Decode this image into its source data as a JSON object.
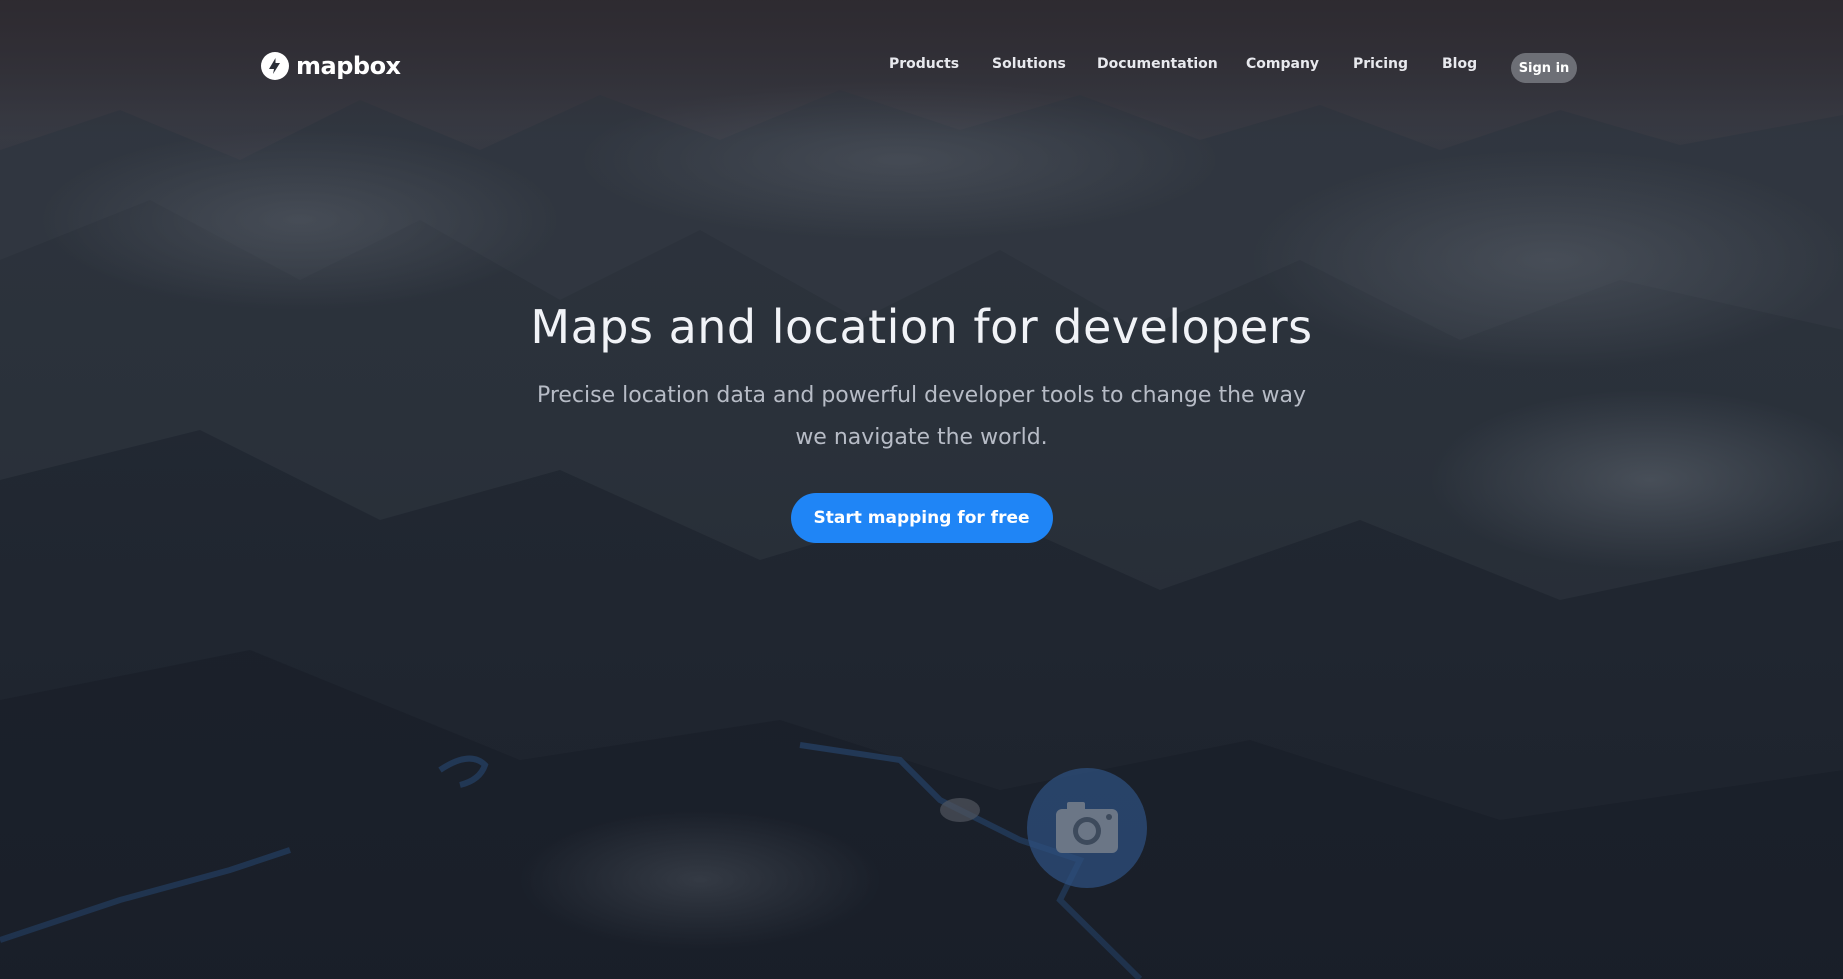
{
  "brand": {
    "name": "mapbox",
    "logo_icon": "mapbox-logo-icon"
  },
  "nav": {
    "links": [
      "Products",
      "Solutions",
      "Documentation",
      "Company",
      "Pricing",
      "Blog"
    ],
    "signin_label": "Sign in"
  },
  "hero": {
    "title": "Maps and location for developers",
    "subtitle": "Precise location data and powerful developer tools to change the way we navigate the world.",
    "cta_label": "Start mapping for free"
  },
  "colors": {
    "accent": "#1f85f6",
    "signin_bg": "#6d6f76",
    "background": "#1b2230"
  }
}
